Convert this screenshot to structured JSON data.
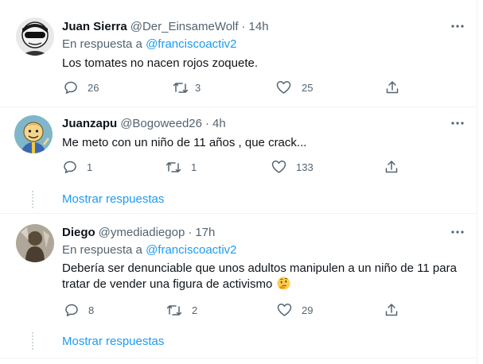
{
  "tweets": [
    {
      "name": "Juan Sierra",
      "handle": "@Der_EinsameWolf",
      "sep": "·",
      "time": "14h",
      "reply_prefix": "En respuesta a",
      "reply_handle": "@franciscoactiv2",
      "text": "Los  tomates no nacen rojos zoquete.",
      "replies": "26",
      "retweets": "3",
      "likes": "25"
    },
    {
      "name": "Juanzapu",
      "handle": "@Bogoweed26",
      "sep": "·",
      "time": "4h",
      "text": "Me meto con un niño de 11 años , que crack...",
      "replies": "1",
      "retweets": "1",
      "likes": "133",
      "show_replies": "Mostrar respuestas"
    },
    {
      "name": "Diego",
      "handle": "@ymediadiegop",
      "sep": "·",
      "time": "17h",
      "reply_prefix": "En respuesta a",
      "reply_handle": "@franciscoactiv2",
      "text_line1": "Debería ser denunciable que unos adultos manipulen a un niño de 11 para",
      "text_line2": "tratar de vender una figura de activismo",
      "replies": "8",
      "retweets": "2",
      "likes": "29",
      "show_replies": "Mostrar respuestas"
    }
  ],
  "colors": {
    "text": "#0f1419",
    "secondary": "#536471",
    "link": "#1d9bf0",
    "border": "#eff3f4"
  },
  "icons": [
    "more-icon",
    "reply-icon",
    "retweet-icon",
    "like-icon",
    "share-icon",
    "thinking-emoji"
  ]
}
